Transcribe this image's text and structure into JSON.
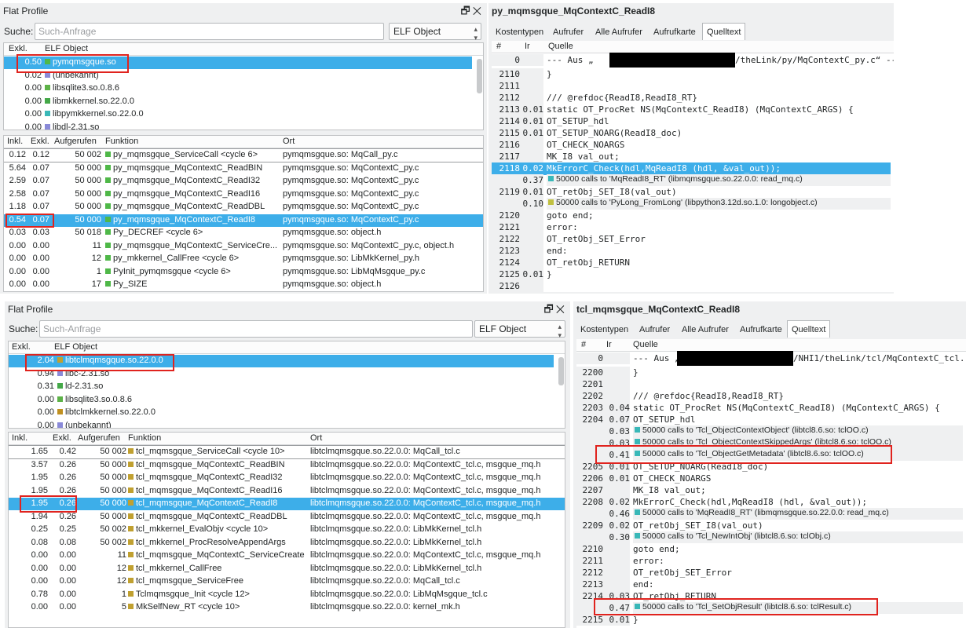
{
  "top": {
    "flat": {
      "title": "Flat Profile",
      "search_label": "Suche:",
      "search_placeholder": "Such-Anfrage",
      "group_select": "ELF Object",
      "group_cols": [
        "Exkl.",
        "ELF Object"
      ],
      "groups": [
        {
          "v": "0.50",
          "name": "pymqmsgque.so",
          "color": "#4fb848"
        },
        {
          "v": "0.02",
          "name": "(unbekannt)",
          "color": "#8a8ad8"
        },
        {
          "v": "0.00",
          "name": "libsqlite3.so.0.8.6",
          "color": "#5db248"
        },
        {
          "v": "0.00",
          "name": "libmkkernel.so.22.0.0",
          "color": "#44a848"
        },
        {
          "v": "0.00",
          "name": "libpymkkernel.so.22.0.0",
          "color": "#39b8b8"
        },
        {
          "v": "0.00",
          "name": "libdl-2.31.so",
          "color": "#8a8ad8"
        }
      ],
      "func_cols": [
        "Inkl.",
        "Exkl.",
        "Aufgerufen",
        "Funktion",
        "Ort"
      ],
      "funcs": [
        {
          "i": "0.12",
          "e": "0.12",
          "c": "50 002",
          "f": "py_mqmsgque_ServiceCall <cycle 6>",
          "o": "pymqmsgque.so: MqCall_py.c"
        },
        {
          "i": "5.64",
          "e": "0.07",
          "c": "50 000",
          "f": "py_mqmsgque_MqContextC_ReadBIN",
          "o": "pymqmsgque.so: MqContextC_py.c"
        },
        {
          "i": "2.59",
          "e": "0.07",
          "c": "50 000",
          "f": "py_mqmsgque_MqContextC_ReadI32",
          "o": "pymqmsgque.so: MqContextC_py.c"
        },
        {
          "i": "2.58",
          "e": "0.07",
          "c": "50 000",
          "f": "py_mqmsgque_MqContextC_ReadI16",
          "o": "pymqmsgque.so: MqContextC_py.c"
        },
        {
          "i": "1.18",
          "e": "0.07",
          "c": "50 000",
          "f": "py_mqmsgque_MqContextC_ReadDBL",
          "o": "pymqmsgque.so: MqContextC_py.c"
        },
        {
          "i": "0.54",
          "e": "0.07",
          "c": "50 000",
          "f": "py_mqmsgque_MqContextC_ReadI8",
          "o": "pymqmsgque.so: MqContextC_py.c"
        },
        {
          "i": "0.03",
          "e": "0.03",
          "c": "50 018",
          "f": "Py_DECREF <cycle 6>",
          "o": "pymqmsgque.so: object.h"
        },
        {
          "i": "0.00",
          "e": "0.00",
          "c": "11",
          "f": "py_mqmsgque_MqContextC_ServiceCre...",
          "o": "pymqmsgque.so: MqContextC_py.c, object.h"
        },
        {
          "i": "0.00",
          "e": "0.00",
          "c": "12",
          "f": "py_mkkernel_CallFree <cycle 6>",
          "o": "pymqmsgque.so: LibMkKernel_py.h"
        },
        {
          "i": "0.00",
          "e": "0.00",
          "c": "1",
          "f": "PyInit_pymqmsgque <cycle 6>",
          "o": "pymqmsgque.so: LibMqMsgque_py.c"
        },
        {
          "i": "0.00",
          "e": "0.00",
          "c": "17",
          "f": "Py_SIZE",
          "o": "pymqmsgque.so: object.h"
        }
      ]
    },
    "detail": {
      "title": "py_mqmsgque_MqContextC_ReadI8",
      "tabs": [
        "Kostentypen",
        "Aufrufer",
        "Alle Aufrufer",
        "Aufrufkarte",
        "Quelltext"
      ],
      "cols": [
        "#",
        "Ir",
        "Quelle"
      ],
      "lines": [
        {
          "n": "0",
          "ir": "",
          "t": "--- Aus „",
          "t2": "/theLink/py/MqContextC_py.c“ --"
        },
        {
          "n": "2110",
          "ir": "",
          "t": "}"
        },
        {
          "n": "2111",
          "ir": "",
          "t": ""
        },
        {
          "n": "2112",
          "ir": "",
          "t": "/// @refdoc{ReadI8,ReadI8_RT}"
        },
        {
          "n": "2113",
          "ir": "0.01",
          "t": "static OT_ProcRet NS(MqContextC_ReadI8) (MqContextC_ARGS) {"
        },
        {
          "n": "2114",
          "ir": "0.01",
          "t": "  OT_SETUP_hdl"
        },
        {
          "n": "2115",
          "ir": "0.01",
          "t": "  OT_SETUP_NOARG(ReadI8_doc)"
        },
        {
          "n": "2116",
          "ir": "",
          "t": "  OT_CHECK_NOARGS"
        },
        {
          "n": "2117",
          "ir": "",
          "t": "  MK_I8 val_out;"
        },
        {
          "n": "2118",
          "ir": "0.02",
          "t": "  MkErrorC_Check(hdl,MqReadI8 (hdl, &val_out));"
        },
        {
          "n": "",
          "ir": "0.37",
          "call": "50000 calls to 'MqReadI8_RT' (libmqmsgque.so.22.0.0: read_mq.c)"
        },
        {
          "n": "2119",
          "ir": "0.01",
          "t": "  OT_retObj_SET_I8(val_out)"
        },
        {
          "n": "",
          "ir": "0.10",
          "call": "50000 calls to 'PyLong_FromLong' (libpython3.12d.so.1.0: longobject.c)"
        },
        {
          "n": "2120",
          "ir": "",
          "t": "  goto end;"
        },
        {
          "n": "2121",
          "ir": "",
          "t": "  error:"
        },
        {
          "n": "2122",
          "ir": "",
          "t": "  OT_retObj_SET_Error"
        },
        {
          "n": "2123",
          "ir": "",
          "t": "  end:"
        },
        {
          "n": "2124",
          "ir": "",
          "t": "  OT_retObj_RETURN"
        },
        {
          "n": "2125",
          "ir": "0.01",
          "t": "}"
        },
        {
          "n": "2126",
          "ir": "",
          "t": ""
        }
      ]
    }
  },
  "bottom": {
    "flat": {
      "title": "Flat Profile",
      "search_label": "Suche:",
      "search_placeholder": "Such-Anfrage",
      "group_select": "ELF Object",
      "group_cols": [
        "Exkl.",
        "ELF Object"
      ],
      "groups": [
        {
          "v": "2.04",
          "name": "libtclmqmsgque.so.22.0.0",
          "color": "#c0a030"
        },
        {
          "v": "0.94",
          "name": "libc-2.31.so",
          "color": "#8a8ad8"
        },
        {
          "v": "0.31",
          "name": "ld-2.31.so",
          "color": "#44a848"
        },
        {
          "v": "0.00",
          "name": "libsqlite3.so.0.8.6",
          "color": "#5db248"
        },
        {
          "v": "0.00",
          "name": "libtclmkkernel.so.22.0.0",
          "color": "#c09020"
        },
        {
          "v": "0.00",
          "name": "(unbekannt)",
          "color": "#8a8ad8"
        }
      ],
      "func_cols": [
        "Inkl.",
        "Exkl.",
        "Aufgerufen",
        "Funktion",
        "Ort"
      ],
      "funcs": [
        {
          "i": "1.65",
          "e": "0.42",
          "c": "50 002",
          "f": "tcl_mqmsgque_ServiceCall <cycle 10>",
          "o": "libtclmqmsgque.so.22.0.0: MqCall_tcl.c"
        },
        {
          "i": "3.57",
          "e": "0.26",
          "c": "50 000",
          "f": "tcl_mqmsgque_MqContextC_ReadBIN",
          "o": "libtclmqmsgque.so.22.0.0: MqContextC_tcl.c, msgque_mq.h"
        },
        {
          "i": "1.95",
          "e": "0.26",
          "c": "50 000",
          "f": "tcl_mqmsgque_MqContextC_ReadI32",
          "o": "libtclmqmsgque.so.22.0.0: MqContextC_tcl.c, msgque_mq.h"
        },
        {
          "i": "1.95",
          "e": "0.26",
          "c": "50 000",
          "f": "tcl_mqmsgque_MqContextC_ReadI16",
          "o": "libtclmqmsgque.so.22.0.0: MqContextC_tcl.c, msgque_mq.h"
        },
        {
          "i": "1.95",
          "e": "0.26",
          "c": "50 000",
          "f": "tcl_mqmsgque_MqContextC_ReadI8",
          "o": "libtclmqmsgque.so.22.0.0: MqContextC_tcl.c, msgque_mq.h"
        },
        {
          "i": "1.94",
          "e": "0.26",
          "c": "50 000",
          "f": "tcl_mqmsgque_MqContextC_ReadDBL",
          "o": "libtclmqmsgque.so.22.0.0: MqContextC_tcl.c, msgque_mq.h"
        },
        {
          "i": "0.25",
          "e": "0.25",
          "c": "50 002",
          "f": "tcl_mkkernel_EvalObjv <cycle 10>",
          "o": "libtclmqmsgque.so.22.0.0: LibMkKernel_tcl.h"
        },
        {
          "i": "0.08",
          "e": "0.08",
          "c": "50 002",
          "f": "tcl_mkkernel_ProcResolveAppendArgs",
          "o": "libtclmqmsgque.so.22.0.0: LibMkKernel_tcl.h"
        },
        {
          "i": "0.00",
          "e": "0.00",
          "c": "11",
          "f": "tcl_mqmsgque_MqContextC_ServiceCreate",
          "o": "libtclmqmsgque.so.22.0.0: MqContextC_tcl.c, msgque_mq.h"
        },
        {
          "i": "0.00",
          "e": "0.00",
          "c": "12",
          "f": "tcl_mkkernel_CallFree",
          "o": "libtclmqmsgque.so.22.0.0: LibMkKernel_tcl.h"
        },
        {
          "i": "0.00",
          "e": "0.00",
          "c": "12",
          "f": "tcl_mqmsgque_ServiceFree",
          "o": "libtclmqmsgque.so.22.0.0: MqCall_tcl.c"
        },
        {
          "i": "0.78",
          "e": "0.00",
          "c": "1",
          "f": "Tclmqmsgque_Init <cycle 12>",
          "o": "libtclmqmsgque.so.22.0.0: LibMqMsgque_tcl.c"
        },
        {
          "i": "0.00",
          "e": "0.00",
          "c": "5",
          "f": "MkSelfNew_RT <cycle 10>",
          "o": "libtclmqmsgque.so.22.0.0: kernel_mk.h"
        }
      ]
    },
    "detail": {
      "title": "tcl_mqmsgque_MqContextC_ReadI8",
      "tabs": [
        "Kostentypen",
        "Aufrufer",
        "Alle Aufrufer",
        "Aufrufkarte",
        "Quelltext"
      ],
      "cols": [
        "#",
        "Ir",
        "Quelle"
      ],
      "lines": [
        {
          "n": "0",
          "ir": "",
          "t": "--- Aus „",
          "t2": "/NHI1/theLink/tcl/MqContextC_tcl."
        },
        {
          "n": "2200",
          "ir": "",
          "t": "}"
        },
        {
          "n": "2201",
          "ir": "",
          "t": ""
        },
        {
          "n": "2202",
          "ir": "",
          "t": "/// @refdoc{ReadI8,ReadI8_RT}"
        },
        {
          "n": "2203",
          "ir": "0.04",
          "t": "static OT_ProcRet NS(MqContextC_ReadI8) (MqContextC_ARGS) {"
        },
        {
          "n": "2204",
          "ir": "0.07",
          "t": "  OT_SETUP_hdl"
        },
        {
          "n": "",
          "ir": "0.03",
          "call": "50000 calls to 'Tcl_ObjectContextObject' (libtcl8.6.so: tclOO.c)"
        },
        {
          "n": "",
          "ir": "0.03",
          "call": "50000 calls to 'Tcl_ObjectContextSkippedArgs' (libtcl8.6.so: tclOO.c)"
        },
        {
          "n": "",
          "ir": "0.41",
          "call": "50000 calls to 'Tcl_ObjectGetMetadata' (libtcl8.6.so: tclOO.c)"
        },
        {
          "n": "2205",
          "ir": "0.01",
          "t": "  OT_SETUP_NOARG(ReadI8_doc)"
        },
        {
          "n": "2206",
          "ir": "0.01",
          "t": "  OT_CHECK_NOARGS"
        },
        {
          "n": "2207",
          "ir": "",
          "t": "  MK_I8 val_out;"
        },
        {
          "n": "2208",
          "ir": "0.02",
          "t": "  MkErrorC_Check(hdl,MqReadI8 (hdl, &val_out));"
        },
        {
          "n": "",
          "ir": "0.46",
          "call": "50000 calls to 'MqReadI8_RT' (libmqmsgque.so.22.0.0: read_mq.c)"
        },
        {
          "n": "2209",
          "ir": "0.02",
          "t": "  OT_retObj_SET_I8(val_out)"
        },
        {
          "n": "",
          "ir": "0.30",
          "call": "50000 calls to 'Tcl_NewIntObj' (libtcl8.6.so: tclObj.c)"
        },
        {
          "n": "2210",
          "ir": "",
          "t": "  goto end;"
        },
        {
          "n": "2211",
          "ir": "",
          "t": "  error:"
        },
        {
          "n": "2212",
          "ir": "",
          "t": "  OT_retObj_SET_Error"
        },
        {
          "n": "2213",
          "ir": "",
          "t": "  end:"
        },
        {
          "n": "2214",
          "ir": "0.03",
          "t": "  OT_retObj_RETURN"
        },
        {
          "n": "",
          "ir": "0.47",
          "call": "50000 calls to 'Tcl_SetObjResult' (libtcl8.6.so: tclResult.c)"
        },
        {
          "n": "2215",
          "ir": "0.01",
          "t": "}"
        }
      ]
    }
  },
  "colors": {
    "selection": "#3daee9",
    "highlight_box": "#e0231e",
    "func_square": "#4fb848",
    "tcl_square": "#c0a030"
  }
}
